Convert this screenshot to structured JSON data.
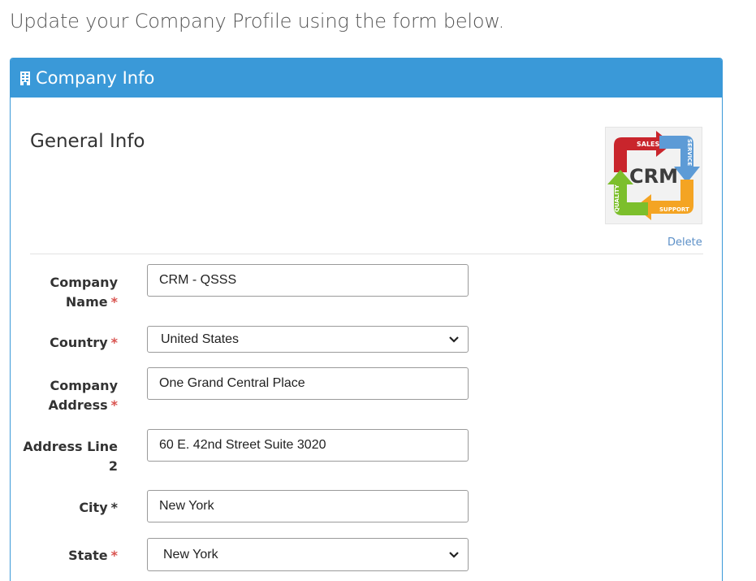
{
  "intro_text": "Update your Company Profile using the form below.",
  "panel": {
    "title": "Company Info",
    "section_title": "General Info",
    "logo_words": {
      "center": "CRM",
      "top": "SALES",
      "right": "SERVICE",
      "bottom": "SUPPORT",
      "left": "QUALITY"
    },
    "delete_label": "Delete"
  },
  "form": {
    "company_name": {
      "label_line1": "Company",
      "label_line2": "Name",
      "required_mark": "*",
      "value": "CRM - QSSS"
    },
    "country": {
      "label": "Country",
      "required_mark": "*",
      "value": "United States"
    },
    "company_address": {
      "label_line1": "Company",
      "label_line2": "Address",
      "required_mark": "*",
      "value": "One Grand Central Place"
    },
    "address_line2": {
      "label_line1": "Address Line",
      "label_line2": "2",
      "value": "60 E. 42nd Street Suite 3020"
    },
    "city": {
      "label": "City",
      "required_mark": "*",
      "value": "New York"
    },
    "state": {
      "label": "State",
      "required_mark": "*",
      "value": "New York"
    }
  },
  "colors": {
    "header_blue": "#3a99d8",
    "required_red": "#d9534f",
    "link_blue": "#5b8fc7"
  },
  "icons": {
    "header": "building-icon",
    "select": "chevron-down-icon"
  }
}
